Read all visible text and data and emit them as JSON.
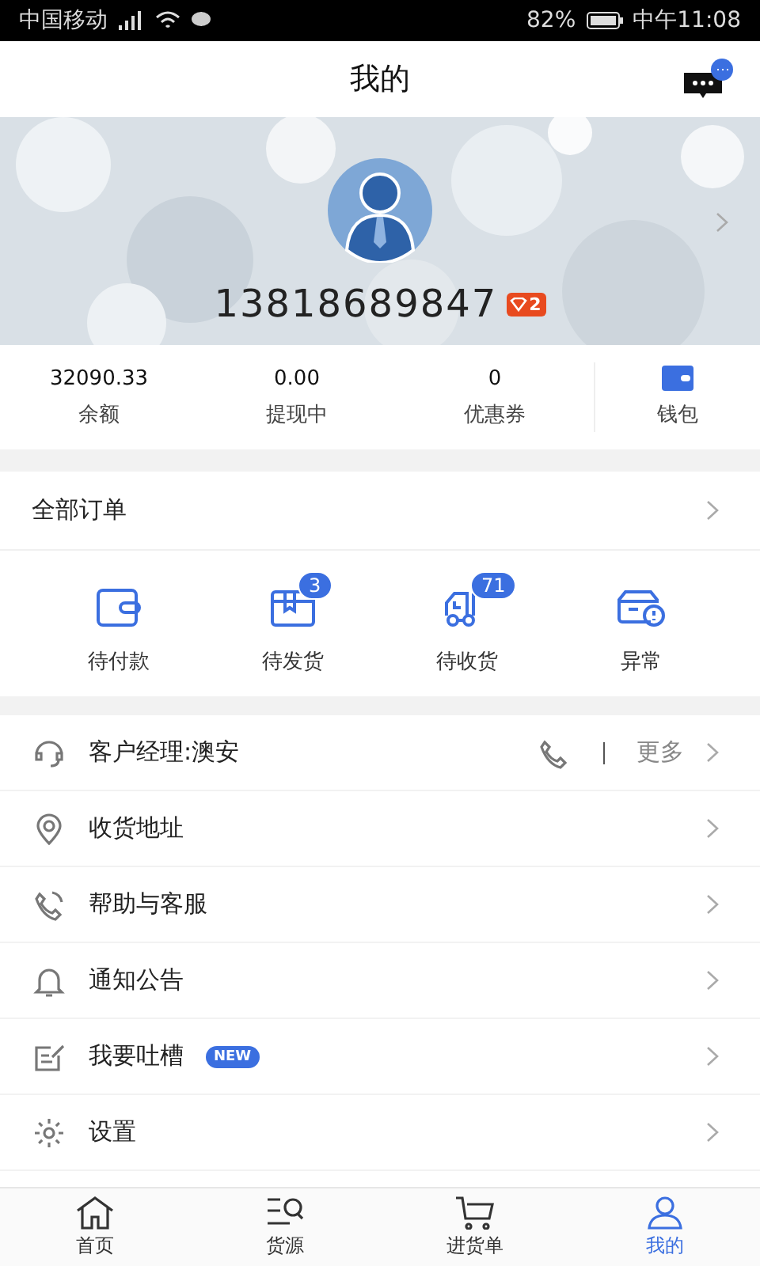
{
  "status_bar": {
    "carrier": "中国移动",
    "battery": "82%",
    "time": "中午11:08"
  },
  "header": {
    "title": "我的"
  },
  "profile": {
    "phone": "13818689847",
    "level": "2"
  },
  "stats": [
    {
      "value": "32090.33",
      "label": "余额"
    },
    {
      "value": "0.00",
      "label": "提现中"
    },
    {
      "value": "0",
      "label": "优惠券"
    }
  ],
  "wallet": {
    "label": "钱包"
  },
  "orders": {
    "title": "全部订单",
    "items": [
      {
        "kind": "pay",
        "label": "待付款"
      },
      {
        "kind": "ship",
        "label": "待发货",
        "badge": "3"
      },
      {
        "kind": "receive",
        "label": "待收货",
        "badge": "71"
      },
      {
        "kind": "issue",
        "label": "异常"
      }
    ]
  },
  "menu": [
    {
      "kind": "manager",
      "label": "客户经理:澳安",
      "more": "更多"
    },
    {
      "kind": "address",
      "label": "收货地址"
    },
    {
      "kind": "help",
      "label": "帮助与客服"
    },
    {
      "kind": "notice",
      "label": "通知公告"
    },
    {
      "kind": "feedback",
      "label": "我要吐槽",
      "tag": "NEW"
    },
    {
      "kind": "settings",
      "label": "设置"
    }
  ],
  "tab_bar": [
    {
      "kind": "home",
      "label": "首页",
      "selected": false
    },
    {
      "kind": "source",
      "label": "货源",
      "selected": false
    },
    {
      "kind": "cart",
      "label": "进货单",
      "selected": false
    },
    {
      "kind": "me",
      "label": "我的",
      "selected": true
    }
  ]
}
